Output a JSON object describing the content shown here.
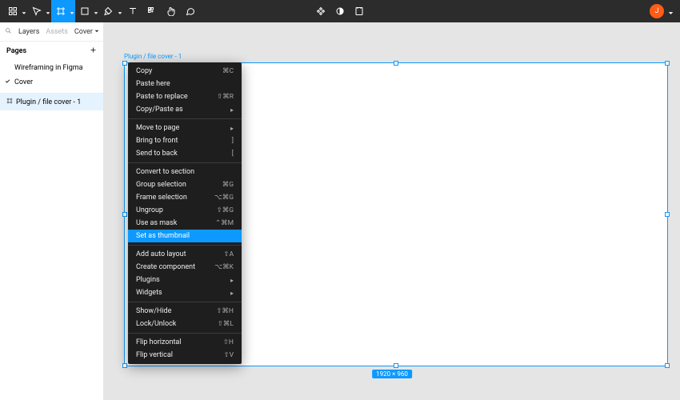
{
  "toolbar": {
    "avatar_initial": "J"
  },
  "sidebar": {
    "tabs": {
      "layers": "Layers",
      "assets": "Assets",
      "cover": "Cover"
    },
    "pages_heading": "Pages",
    "pages": [
      {
        "name": "Wireframing in Figma",
        "checked": false
      },
      {
        "name": "Cover",
        "checked": true
      }
    ],
    "selected_layer": "Plugin / file cover - 1"
  },
  "canvas": {
    "frame_label": "Plugin / file cover - 1",
    "dimensions": "1920 × 960"
  },
  "context_menu": {
    "groups": [
      [
        {
          "label": "Copy",
          "shortcut": "⌘C"
        },
        {
          "label": "Paste here",
          "shortcut": ""
        },
        {
          "label": "Paste to replace",
          "shortcut": "⇧⌘R"
        },
        {
          "label": "Copy/Paste as",
          "submenu": true
        }
      ],
      [
        {
          "label": "Move to page",
          "submenu": true
        },
        {
          "label": "Bring to front",
          "shortcut": "]"
        },
        {
          "label": "Send to back",
          "shortcut": "["
        }
      ],
      [
        {
          "label": "Convert to section",
          "shortcut": ""
        },
        {
          "label": "Group selection",
          "shortcut": "⌘G"
        },
        {
          "label": "Frame selection",
          "shortcut": "⌥⌘G"
        },
        {
          "label": "Ungroup",
          "shortcut": "⇧⌘G"
        },
        {
          "label": "Use as mask",
          "shortcut": "⌃⌘M"
        },
        {
          "label": "Set as thumbnail",
          "highlight": true
        }
      ],
      [
        {
          "label": "Add auto layout",
          "shortcut": "⇧A"
        },
        {
          "label": "Create component",
          "shortcut": "⌥⌘K"
        },
        {
          "label": "Plugins",
          "submenu": true
        },
        {
          "label": "Widgets",
          "submenu": true
        }
      ],
      [
        {
          "label": "Show/Hide",
          "shortcut": "⇧⌘H"
        },
        {
          "label": "Lock/Unlock",
          "shortcut": "⇧⌘L"
        }
      ],
      [
        {
          "label": "Flip horizontal",
          "shortcut": "⇧H"
        },
        {
          "label": "Flip vertical",
          "shortcut": "⇧V"
        }
      ]
    ]
  }
}
